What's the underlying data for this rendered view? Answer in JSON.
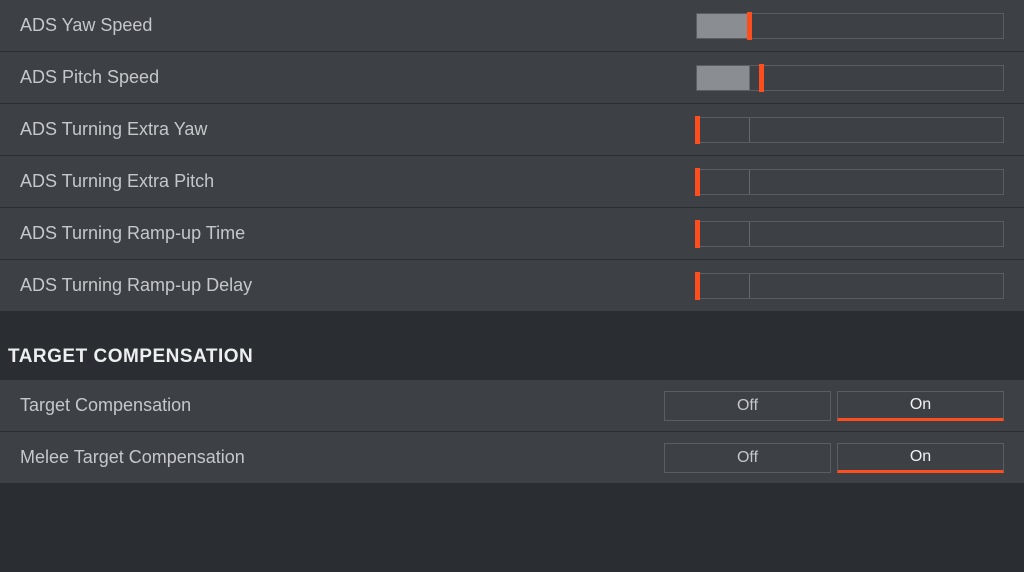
{
  "colors": {
    "accent": "#ff4e1d",
    "row_bg": "#3d4045",
    "bg": "#2a2d32"
  },
  "sliders": [
    {
      "label": "ADS Yaw Speed",
      "fill_pct": 17,
      "handle_pct": 17,
      "tick_pct": 17
    },
    {
      "label": "ADS Pitch Speed",
      "fill_pct": 17,
      "handle_pct": 21,
      "tick_pct": 17
    },
    {
      "label": "ADS Turning Extra Yaw",
      "fill_pct": 0,
      "handle_pct": 0,
      "tick_pct": 17
    },
    {
      "label": "ADS Turning Extra Pitch",
      "fill_pct": 0,
      "handle_pct": 0,
      "tick_pct": 17
    },
    {
      "label": "ADS Turning Ramp-up Time",
      "fill_pct": 0,
      "handle_pct": 0,
      "tick_pct": 17
    },
    {
      "label": "ADS Turning Ramp-up Delay",
      "fill_pct": 0,
      "handle_pct": 0,
      "tick_pct": 17
    }
  ],
  "section_header": "TARGET COMPENSATION",
  "toggles": [
    {
      "label": "Target Compensation",
      "options": [
        "Off",
        "On"
      ],
      "selected": 1
    },
    {
      "label": "Melee Target Compensation",
      "options": [
        "Off",
        "On"
      ],
      "selected": 1
    }
  ]
}
